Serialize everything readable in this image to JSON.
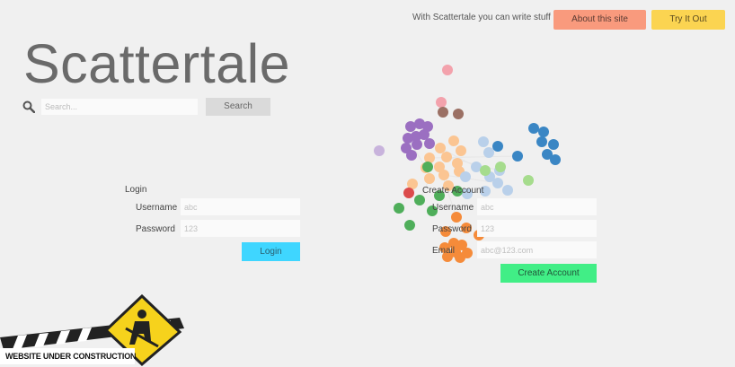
{
  "header": {
    "tagline": "With Scattertale you can write stuff",
    "about_label": "About this site",
    "try_label": "Try It Out",
    "about_color": "#f99a7d",
    "try_color": "#fbd451"
  },
  "brand": {
    "title": "Scattertale"
  },
  "search": {
    "placeholder": "Search...",
    "button_label": "Search",
    "icon": "search-icon"
  },
  "login": {
    "heading": "Login",
    "username_label": "Username",
    "username_placeholder": "abc",
    "password_label": "Password",
    "password_placeholder": "123",
    "submit_label": "Login",
    "submit_color": "#3fd6ff"
  },
  "create_account": {
    "heading": "Create Account",
    "username_label": "Username",
    "username_placeholder": "abc",
    "password_label": "Password",
    "password_placeholder": "123",
    "email_label": "Email",
    "email_placeholder": "abc@123.com",
    "submit_label": "Create Account",
    "submit_color": "#41ee86"
  },
  "banner": {
    "text": "WEBSITE UNDER CONSTRUCTION",
    "icon": "construction-worker-icon"
  },
  "graph_colors": {
    "purple": "#9b6fc1",
    "light_purple": "#c8b3dc",
    "peach": "#fbc592",
    "orange": "#f58b3a",
    "blue": "#3a86c4",
    "light_blue": "#b9d0ea",
    "green": "#4fae5a",
    "light_green": "#a6dc8d",
    "pink": "#f3a2ac",
    "red": "#db4b4b",
    "brown": "#9b7064"
  }
}
